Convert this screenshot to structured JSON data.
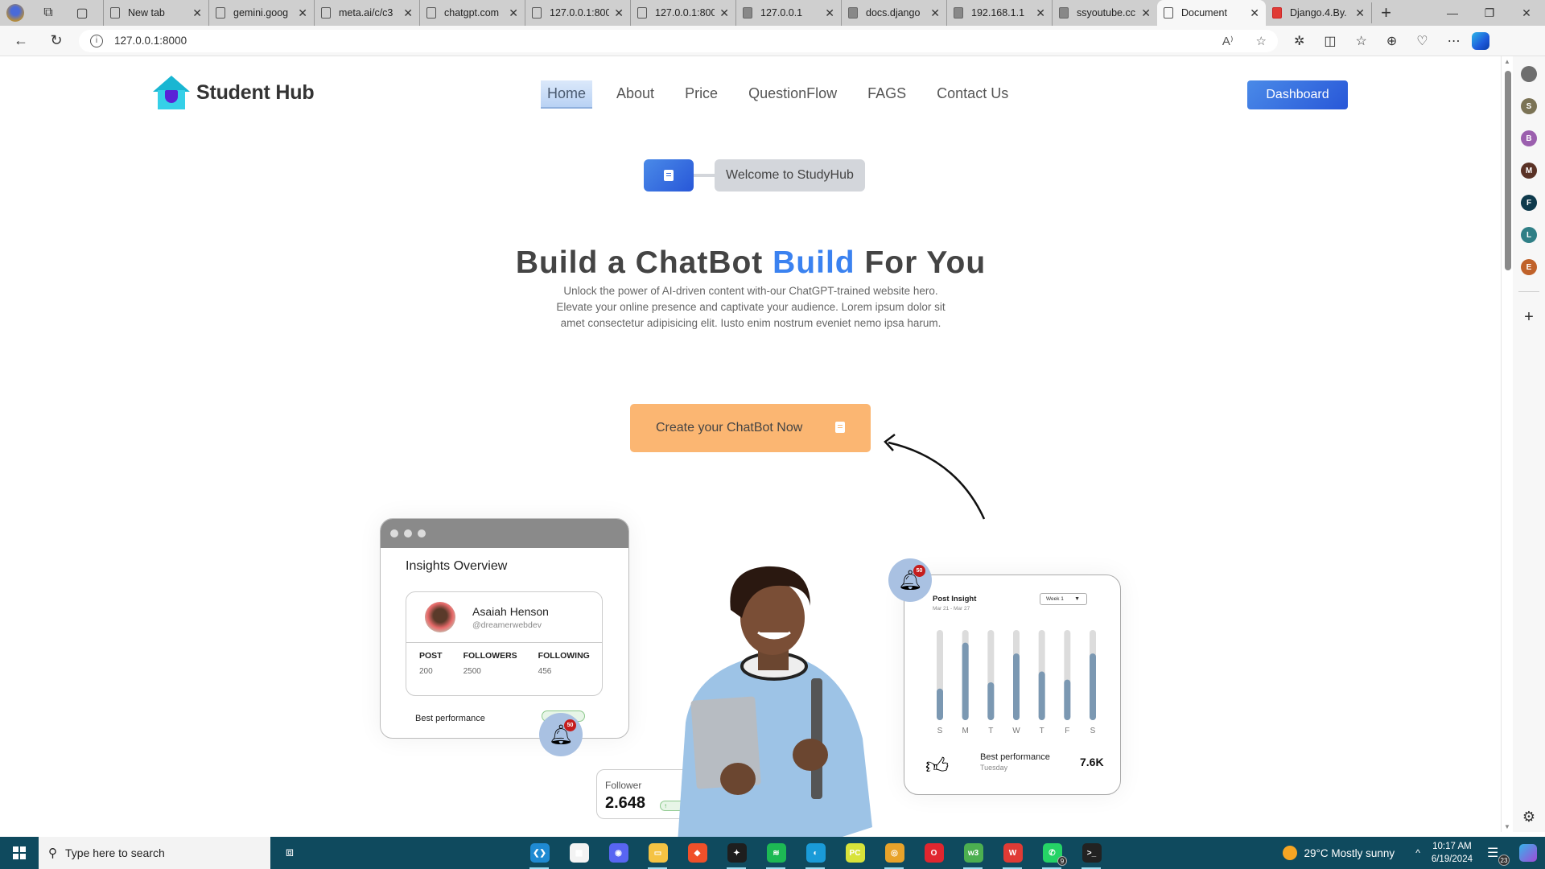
{
  "browser": {
    "tabs": [
      {
        "label": "New tab",
        "icon": "newtab-icon",
        "active": false
      },
      {
        "label": "gemini.goog",
        "icon": "page-icon",
        "active": false
      },
      {
        "label": "meta.ai/c/c3",
        "icon": "page-icon",
        "active": false
      },
      {
        "label": "chatgpt.com",
        "icon": "page-icon",
        "active": false
      },
      {
        "label": "127.0.0.1:800",
        "icon": "page-icon",
        "active": false
      },
      {
        "label": "127.0.0.1:800",
        "icon": "page-icon",
        "active": false
      },
      {
        "label": "127.0.0.1",
        "icon": "error-page-icon",
        "active": false
      },
      {
        "label": "docs.django",
        "icon": "error-page-icon",
        "active": false
      },
      {
        "label": "192.168.1.1",
        "icon": "error-page-icon",
        "active": false
      },
      {
        "label": "ssyoutube.cc",
        "icon": "error-page-icon",
        "active": false
      },
      {
        "label": "Document",
        "icon": "page-icon",
        "active": true
      },
      {
        "label": "Django.4.By.",
        "icon": "pdf-icon",
        "active": false
      }
    ],
    "url": "127.0.0.1:8000",
    "close_glyph": "✕",
    "new_tab_glyph": "+",
    "window_controls": {
      "minimize": "—",
      "maximize": "❐",
      "close": "✕"
    },
    "sidebar_profiles": [
      {
        "letter": "",
        "color": "#6e6e6e"
      },
      {
        "letter": "S",
        "color": "#7b7355"
      },
      {
        "letter": "B",
        "color": "#9b5fae"
      },
      {
        "letter": "M",
        "color": "#5a3226"
      },
      {
        "letter": "F",
        "color": "#0e3a4c"
      },
      {
        "letter": "L",
        "color": "#2f7f86"
      },
      {
        "letter": "E",
        "color": "#c0622a"
      }
    ]
  },
  "site": {
    "brand": "Student Hub",
    "nav": [
      {
        "label": "Home",
        "active": true
      },
      {
        "label": "About",
        "active": false
      },
      {
        "label": "Price",
        "active": false
      },
      {
        "label": "QuestionFlow",
        "active": false
      },
      {
        "label": "FAGS",
        "active": false
      },
      {
        "label": "Contact Us",
        "active": false
      }
    ],
    "dashboard_label": "Dashboard",
    "welcome": "Welcome to StudyHub",
    "hero": {
      "title_part1": "Build a ChatBot ",
      "title_accent": "Build",
      "title_part2": " For You",
      "subtitle": "Unlock the power of AI-driven content with-our ChatGPT-trained website hero. Elevate your online presence and captivate your audience. Lorem ipsum dolor sit amet consectetur adipisicing elit. Iusto enim nostrum eveniet nemo ipsa harum."
    },
    "cta_label": "Create your ChatBot Now",
    "colors": {
      "accent": "#3b82f0",
      "cta": "#fbb672",
      "bar_fill": "#7b98b2",
      "bar_track": "#dcdcdc"
    }
  },
  "insights_card": {
    "title": "Insights Overview",
    "name": "Asaiah Henson",
    "handle": "@dreamerwebdev",
    "stats": [
      {
        "label": "POST",
        "value": "200"
      },
      {
        "label": "FOLLOWERS",
        "value": "2500"
      },
      {
        "label": "FOLLOWING",
        "value": "456"
      }
    ],
    "best_performance": "Best performance",
    "notification_count": "50"
  },
  "follower_card": {
    "label": "Follower",
    "value": "2.648",
    "trend_glyph": "↑"
  },
  "post_insight": {
    "title": "Post Insight",
    "date_range": "Mar 21 - Mar 27",
    "select_value": "Week 1",
    "notification_count": "50",
    "best_label": "Best performance",
    "best_day": "Tuesday",
    "best_value": "7.6K"
  },
  "chart_data": {
    "type": "bar",
    "title": "Post Insight",
    "categories": [
      "S",
      "M",
      "T",
      "W",
      "T",
      "F",
      "S"
    ],
    "values": [
      0.35,
      0.86,
      0.42,
      0.74,
      0.54,
      0.45,
      0.74
    ],
    "ylim": [
      0,
      1
    ],
    "xlabel": "",
    "ylabel": "",
    "grid": false
  },
  "taskbar": {
    "search_placeholder": "Type here to search",
    "apps": [
      {
        "name": "vscode",
        "color": "#1f8ad2",
        "glyph": "❮❯",
        "running": true,
        "count": ""
      },
      {
        "name": "store",
        "color": "#f3f3f3",
        "glyph": "▦",
        "running": false,
        "count": ""
      },
      {
        "name": "discord",
        "color": "#5865f2",
        "glyph": "◉",
        "running": false,
        "count": ""
      },
      {
        "name": "file-explorer",
        "color": "#f5c343",
        "glyph": "▭",
        "running": true,
        "count": ""
      },
      {
        "name": "brave",
        "color": "#f0502a",
        "glyph": "◆",
        "running": false,
        "count": ""
      },
      {
        "name": "figma",
        "color": "#1e1e1e",
        "glyph": "✦",
        "running": true,
        "count": ""
      },
      {
        "name": "spotify",
        "color": "#1db954",
        "glyph": "≋",
        "running": true,
        "count": ""
      },
      {
        "name": "edge",
        "color": "#1a9bd8",
        "glyph": "◐",
        "running": true,
        "count": ""
      },
      {
        "name": "pycharm",
        "color": "#d8e33a",
        "glyph": "PC",
        "running": false,
        "count": ""
      },
      {
        "name": "chrome",
        "color": "#e8a32a",
        "glyph": "◎",
        "running": true,
        "count": ""
      },
      {
        "name": "opera",
        "color": "#e0262f",
        "glyph": "O",
        "running": false,
        "count": ""
      },
      {
        "name": "w3schools",
        "color": "#4caf50",
        "glyph": "w3",
        "running": true,
        "count": ""
      },
      {
        "name": "wps-office",
        "color": "#e03b35",
        "glyph": "W",
        "running": true,
        "count": ""
      },
      {
        "name": "whatsapp",
        "color": "#25d366",
        "glyph": "✆",
        "running": true,
        "count": "9"
      },
      {
        "name": "terminal",
        "color": "#222",
        "glyph": ">_",
        "running": true,
        "count": ""
      }
    ],
    "weather": "29°C  Mostly sunny",
    "time": "10:17 AM",
    "date": "6/19/2024",
    "notifications": "23"
  }
}
